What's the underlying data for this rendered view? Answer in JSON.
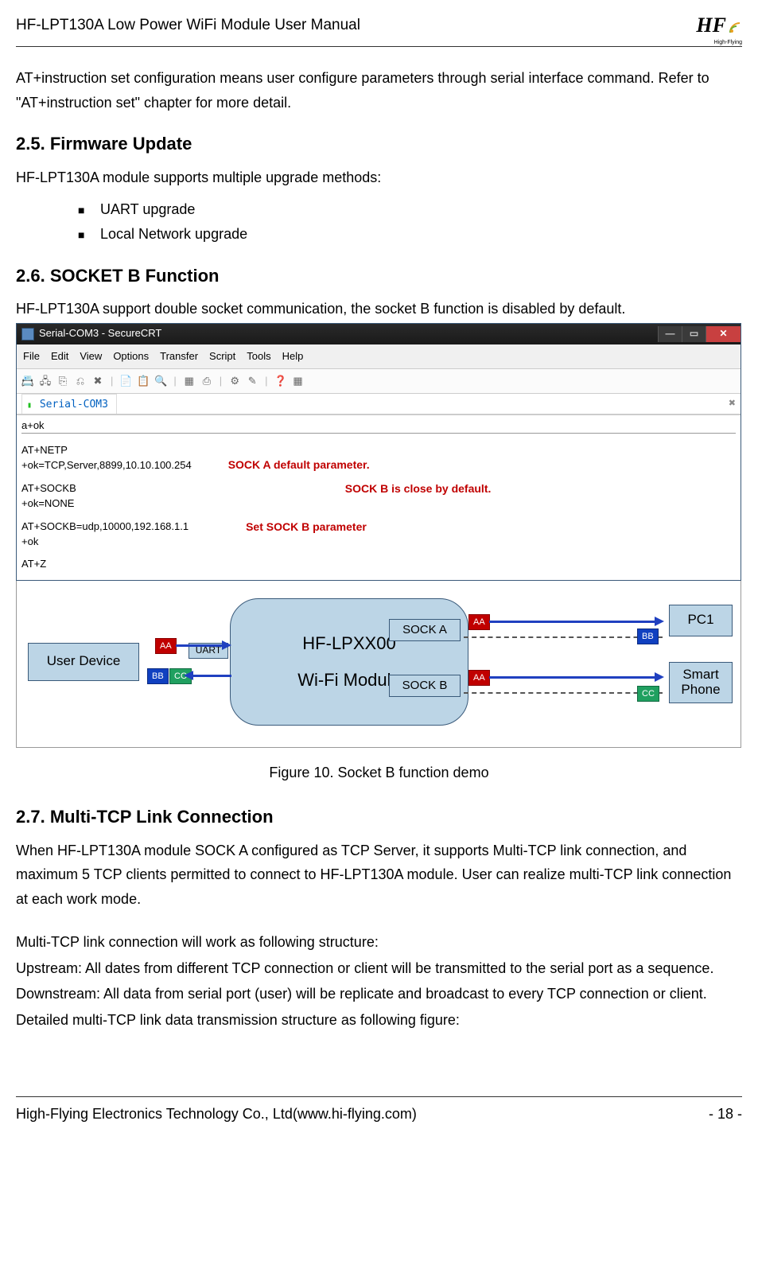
{
  "header": {
    "title": "HF-LPT130A Low Power WiFi Module User Manual",
    "logo_company": "High-Flying",
    "logo_text": "HF"
  },
  "intro": "AT+instruction set configuration means user configure parameters through serial interface command. Refer to \"AT+instruction set\" chapter for more detail.",
  "sec25": {
    "num": "2.5.",
    "title": "Firmware Update",
    "lead": "HF-LPT130A module supports multiple upgrade methods:",
    "items": [
      "UART upgrade",
      "Local Network upgrade"
    ]
  },
  "sec26": {
    "num": "2.6.",
    "title": "SOCKET B Function",
    "lead": "HF-LPT130A support double socket communication, the socket B function is disabled by default."
  },
  "crt": {
    "window_title": "Serial-COM3 - SecureCRT",
    "menus": [
      "File",
      "Edit",
      "View",
      "Options",
      "Transfer",
      "Script",
      "Tools",
      "Help"
    ],
    "tab": "Serial-COM3",
    "lines": [
      "a+ok",
      "",
      "AT+NETP",
      "+ok=TCP,Server,8899,10.10.100.254",
      "",
      "AT+SOCKB",
      "+ok=NONE",
      "",
      "AT+SOCKB=udp,10000,192.168.1.1",
      "+ok",
      "",
      "AT+Z"
    ],
    "notes": {
      "a": "SOCK A default parameter.",
      "b": "SOCK B is close by default.",
      "c": "Set SOCK B parameter"
    }
  },
  "diagram": {
    "user_device": "User Device",
    "uart": "UART",
    "module": "HF-LPXX00",
    "module_sub": "Wi-Fi Module",
    "sock_a": "SOCK A",
    "sock_b": "SOCK B",
    "pc1": "PC1",
    "phone_l1": "Smart",
    "phone_l2": "Phone",
    "badges": {
      "aa": "AA",
      "bb": "BB",
      "cc": "CC"
    }
  },
  "figure_caption": "Figure 10.   Socket B function demo",
  "sec27": {
    "num": "2.7.",
    "title": "Multi-TCP Link Connection",
    "p1": "When HF-LPT130A module SOCK A configured as TCP Server, it supports Multi-TCP link connection, and maximum 5 TCP clients permitted to connect to HF-LPT130A module. User can realize multi-TCP link connection at each work mode.",
    "p2": "Multi-TCP link connection will work as following structure:",
    "p3": "Upstream: All dates from different TCP connection or client will be transmitted to the serial port as a sequence.",
    "p4": "Downstream: All data from serial port (user) will be replicate and broadcast to every TCP connection or client.",
    "p5": "Detailed multi-TCP link data transmission structure as following figure:"
  },
  "footer": {
    "left": "High-Flying Electronics Technology Co., Ltd(www.hi-flying.com)",
    "right": "- 18 -"
  }
}
